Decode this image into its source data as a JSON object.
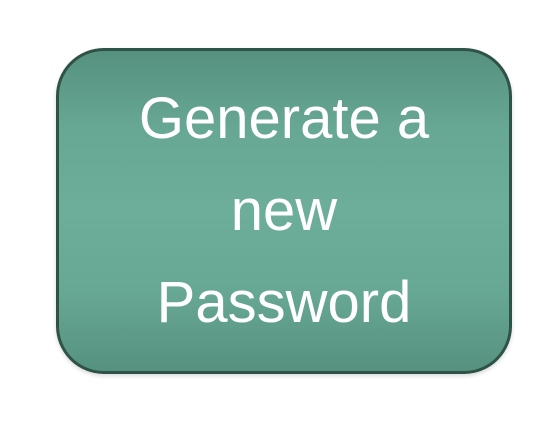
{
  "box": {
    "lines": [
      "Generate a",
      "new",
      "Password"
    ],
    "fill_color": "#67a894",
    "border_color": "#2f5247",
    "text_color": "#ffffff"
  }
}
